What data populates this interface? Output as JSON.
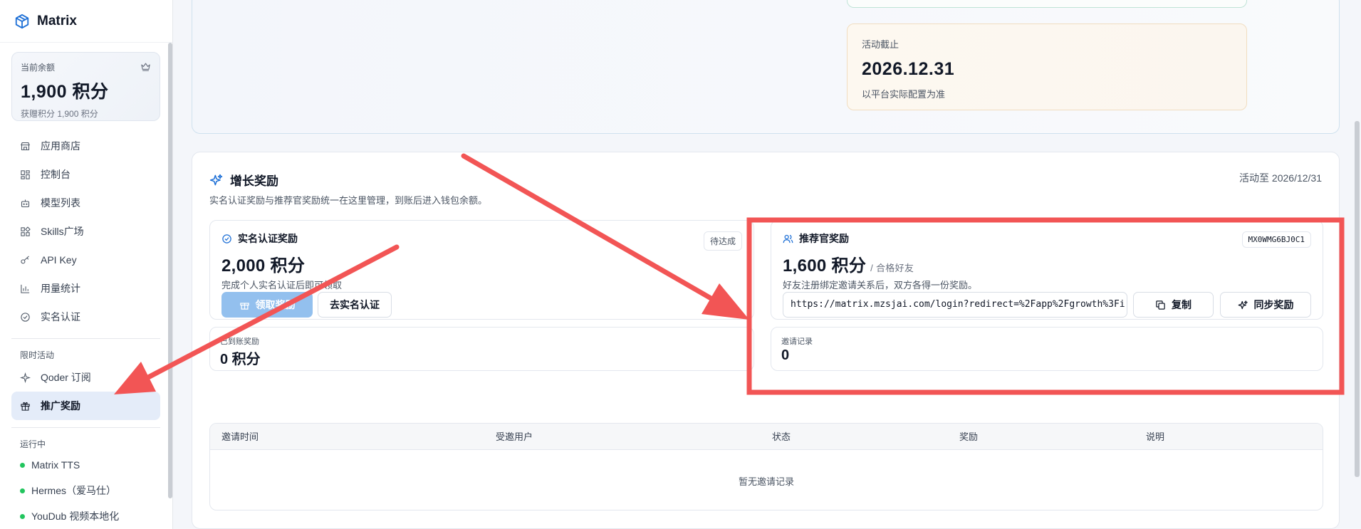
{
  "brand": {
    "name": "Matrix"
  },
  "balance": {
    "label": "当前余额",
    "value": "1,900 积分",
    "sub": "获赠积分 1,900 积分"
  },
  "nav": {
    "items": [
      {
        "label": "应用商店",
        "icon": "store-icon"
      },
      {
        "label": "控制台",
        "icon": "grid-icon"
      },
      {
        "label": "模型列表",
        "icon": "bot-icon"
      },
      {
        "label": "Skills广场",
        "icon": "blocks-icon"
      },
      {
        "label": "API Key",
        "icon": "key-icon"
      },
      {
        "label": "用量统计",
        "icon": "bar-chart-icon"
      },
      {
        "label": "实名认证",
        "icon": "check-circle-icon"
      }
    ],
    "limited_section": "限时活动",
    "limited_items": [
      {
        "label": "Qoder 订阅",
        "icon": "sparkle-icon"
      },
      {
        "label": "推广奖励",
        "icon": "gift-icon",
        "active": true
      }
    ],
    "running_section": "运行中",
    "running_items": [
      {
        "label": "Matrix TTS"
      },
      {
        "label": "Hermes（爱马仕）"
      },
      {
        "label": "YouDub 视频本地化"
      }
    ],
    "status_color": "#22c55e"
  },
  "deadline": {
    "label": "活动截止",
    "date": "2026.12.31",
    "note": "以平台实际配置为准"
  },
  "growth": {
    "title": "增长奖励",
    "desc": "实名认证奖励与推荐官奖励统一在这里管理，到账后进入钱包余额。",
    "until": "活动至 2026/12/31",
    "realname": {
      "title": "实名认证奖励",
      "badge": "待达成",
      "value": "2,000 积分",
      "desc": "完成个人实名认证后即可领取",
      "claim_button": "领取奖励",
      "verify_button": "去实名认证"
    },
    "referral": {
      "title": "推荐官奖励",
      "code": "MX0WMG6BJ0C1",
      "value": "1,600 积分",
      "unit": "/ 合格好友",
      "desc": "好友注册绑定邀请关系后，双方各得一份奖励。",
      "link": "https://matrix.mzsjai.com/login?redirect=%2Fapp%2Fgrowth%3Fi",
      "copy_button": "复制",
      "sync_button": "同步奖励"
    },
    "credited": {
      "label": "已到账奖励",
      "value": "0 积分"
    },
    "records": {
      "label": "邀请记录",
      "value": "0"
    },
    "table": {
      "columns": [
        "邀请时间",
        "受邀用户",
        "状态",
        "奖励",
        "说明"
      ],
      "empty": "暂无邀请记录"
    }
  },
  "annotation_color": "#f25555"
}
